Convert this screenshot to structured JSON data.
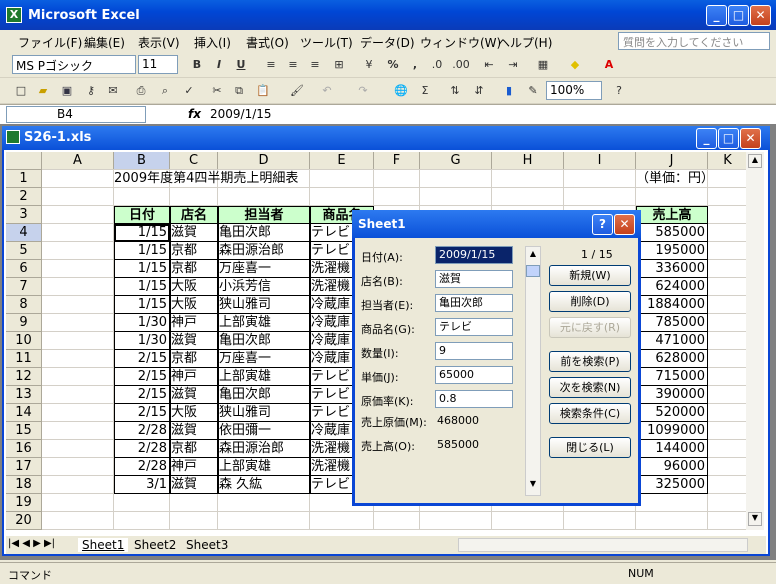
{
  "app": {
    "title": "Microsoft Excel",
    "icon": "excel-icon"
  },
  "menu": [
    "ファイル(F)",
    "編集(E)",
    "表示(V)",
    "挿入(I)",
    "書式(O)",
    "ツール(T)",
    "データ(D)",
    "ウィンドウ(W)",
    "ヘルプ(H)"
  ],
  "help_placeholder": "質問を入力してください",
  "font": {
    "name": "MS Pゴシック",
    "size": "11"
  },
  "zoom": "100%",
  "namebox": "B4",
  "formula": "2009/1/15",
  "workbook": {
    "title": "S26-1.xls"
  },
  "columns": [
    "A",
    "B",
    "C",
    "D",
    "E",
    "F",
    "G",
    "H",
    "I",
    "J",
    "K"
  ],
  "rows": [
    "1",
    "2",
    "3",
    "4",
    "5",
    "6",
    "7",
    "8",
    "9",
    "10",
    "11",
    "12",
    "13",
    "14",
    "15",
    "16",
    "17",
    "18",
    "19",
    "20"
  ],
  "sheet": {
    "title": "2009年度第4四半期売上明細表",
    "unit": "（単価：円）",
    "headers": {
      "date": "日付",
      "store": "店名",
      "person": "担当者",
      "product": "商品名",
      "sales": "売上高"
    },
    "data": [
      [
        "1/15",
        "滋賀",
        "亀田次郎",
        "テレビ",
        "585000"
      ],
      [
        "1/15",
        "京都",
        "森田源治郎",
        "テレビ",
        "195000"
      ],
      [
        "1/15",
        "京都",
        "万座喜一",
        "洗濯機",
        "336000"
      ],
      [
        "1/15",
        "大阪",
        "小浜芳信",
        "洗濯機",
        "624000"
      ],
      [
        "1/15",
        "大阪",
        "狭山雅司",
        "冷蔵庫",
        "1884000"
      ],
      [
        "1/30",
        "神戸",
        "上部寅雄",
        "冷蔵庫",
        "785000"
      ],
      [
        "1/30",
        "滋賀",
        "亀田次郎",
        "冷蔵庫",
        "471000"
      ],
      [
        "2/15",
        "京都",
        "万座喜一",
        "冷蔵庫",
        "628000"
      ],
      [
        "2/15",
        "神戸",
        "上部寅雄",
        "テレビ",
        "715000"
      ],
      [
        "2/15",
        "滋賀",
        "亀田次郎",
        "テレビ",
        "390000"
      ],
      [
        "2/15",
        "大阪",
        "狭山雅司",
        "テレビ",
        "520000"
      ],
      [
        "2/28",
        "滋賀",
        "依田彌一",
        "冷蔵庫",
        "1099000"
      ],
      [
        "2/28",
        "京都",
        "森田源治郎",
        "洗濯機",
        "144000"
      ],
      [
        "2/28",
        "神戸",
        "上部寅雄",
        "洗濯機",
        "96000"
      ],
      [
        "3/1",
        "滋賀",
        "森 久紘",
        "テレビ",
        "325000"
      ]
    ]
  },
  "tabs": [
    "Sheet1",
    "Sheet2",
    "Sheet3"
  ],
  "status": {
    "left": "コマンド",
    "right": "NUM"
  },
  "dialog": {
    "title": "Sheet1",
    "record": "1 / 15",
    "fields": [
      {
        "label": "日付(A):",
        "value": "2009/1/15"
      },
      {
        "label": "店名(B):",
        "value": "滋賀"
      },
      {
        "label": "担当者(E):",
        "value": "亀田次郎"
      },
      {
        "label": "商品名(G):",
        "value": "テレビ"
      },
      {
        "label": "数量(I):",
        "value": "9"
      },
      {
        "label": "単価(J):",
        "value": "65000"
      },
      {
        "label": "原価率(K):",
        "value": "0.8"
      }
    ],
    "computed": [
      {
        "label": "売上原価(M):",
        "value": "468000"
      },
      {
        "label": "売上高(O):",
        "value": "585000"
      }
    ],
    "buttons": {
      "new": "新規(W)",
      "delete": "削除(D)",
      "restore": "元に戻す(R)",
      "prev": "前を検索(P)",
      "next": "次を検索(N)",
      "criteria": "検索条件(C)",
      "close": "閉じる(L)"
    }
  }
}
